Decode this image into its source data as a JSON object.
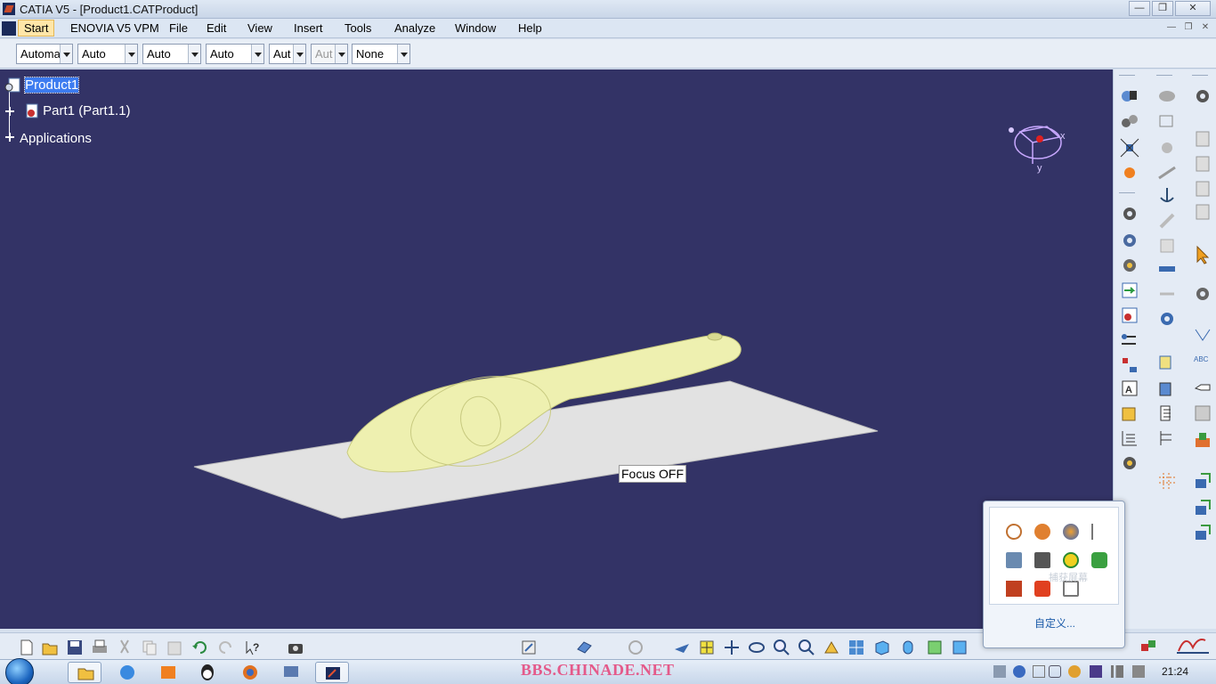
{
  "window": {
    "title": "CATIA V5 - [Product1.CATProduct]",
    "controls": [
      "—",
      "❐",
      "✕"
    ],
    "mdi_controls": [
      "—",
      "❐",
      "✕"
    ]
  },
  "menu": {
    "items": [
      "Start",
      "ENOVIA V5 VPM",
      "File",
      "Edit",
      "View",
      "Insert",
      "Tools",
      "Analyze",
      "Window",
      "Help"
    ]
  },
  "graphic_properties": {
    "combos": [
      {
        "value": "Automa",
        "enabled": true
      },
      {
        "value": "Auto",
        "enabled": true
      },
      {
        "value": "Auto",
        "enabled": true
      },
      {
        "value": "Auto",
        "enabled": true
      },
      {
        "value": "Aut",
        "enabled": true
      },
      {
        "value": "Aut",
        "enabled": false
      },
      {
        "value": "None",
        "enabled": true
      }
    ]
  },
  "tree": {
    "root": "Product1",
    "part": "Part1 (Part1.1)",
    "applications": "Applications"
  },
  "viewport": {
    "background": "#333366",
    "model_color": "#eef0b0",
    "plane_color": "#e2e2e2",
    "focus_label": "Focus OFF",
    "compass": {
      "x": "x",
      "y": "y"
    }
  },
  "tray_popup": {
    "customize": "自定义...",
    "hint": "捕获屏幕"
  },
  "taskbar": {
    "watermark": "BBS.CHINADE.NET",
    "clock": "21:24"
  },
  "icons": {
    "start_orb": "windows-start-icon",
    "right_toolbar": [
      "assembly-constraint-icon",
      "snap-icon",
      "explode-icon",
      "manipulate-icon",
      "fix-icon",
      "catalog-icon"
    ],
    "bottom_toolbar": [
      "new-icon",
      "open-icon",
      "save-icon",
      "print-icon",
      "cut-icon",
      "copy-icon",
      "paste-icon",
      "undo-icon",
      "redo-icon",
      "whats-this-icon",
      "capture-icon",
      "update-icon",
      "fly-icon",
      "fit-all-icon",
      "pan-icon",
      "rotate-icon",
      "zoom-in-icon",
      "zoom-out-icon",
      "normal-view-icon",
      "multi-view-icon",
      "iso-view-icon",
      "shading-icon",
      "hide-show-icon"
    ]
  }
}
